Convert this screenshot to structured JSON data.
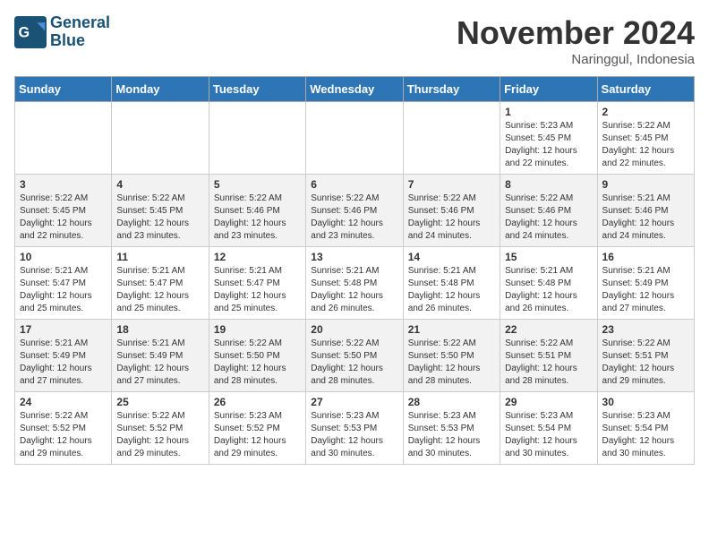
{
  "header": {
    "logo_line1": "General",
    "logo_line2": "Blue",
    "month": "November 2024",
    "location": "Naringgul, Indonesia"
  },
  "days_of_week": [
    "Sunday",
    "Monday",
    "Tuesday",
    "Wednesday",
    "Thursday",
    "Friday",
    "Saturday"
  ],
  "weeks": [
    [
      {
        "day": "",
        "info": ""
      },
      {
        "day": "",
        "info": ""
      },
      {
        "day": "",
        "info": ""
      },
      {
        "day": "",
        "info": ""
      },
      {
        "day": "",
        "info": ""
      },
      {
        "day": "1",
        "info": "Sunrise: 5:23 AM\nSunset: 5:45 PM\nDaylight: 12 hours\nand 22 minutes."
      },
      {
        "day": "2",
        "info": "Sunrise: 5:22 AM\nSunset: 5:45 PM\nDaylight: 12 hours\nand 22 minutes."
      }
    ],
    [
      {
        "day": "3",
        "info": "Sunrise: 5:22 AM\nSunset: 5:45 PM\nDaylight: 12 hours\nand 22 minutes."
      },
      {
        "day": "4",
        "info": "Sunrise: 5:22 AM\nSunset: 5:45 PM\nDaylight: 12 hours\nand 23 minutes."
      },
      {
        "day": "5",
        "info": "Sunrise: 5:22 AM\nSunset: 5:46 PM\nDaylight: 12 hours\nand 23 minutes."
      },
      {
        "day": "6",
        "info": "Sunrise: 5:22 AM\nSunset: 5:46 PM\nDaylight: 12 hours\nand 23 minutes."
      },
      {
        "day": "7",
        "info": "Sunrise: 5:22 AM\nSunset: 5:46 PM\nDaylight: 12 hours\nand 24 minutes."
      },
      {
        "day": "8",
        "info": "Sunrise: 5:22 AM\nSunset: 5:46 PM\nDaylight: 12 hours\nand 24 minutes."
      },
      {
        "day": "9",
        "info": "Sunrise: 5:21 AM\nSunset: 5:46 PM\nDaylight: 12 hours\nand 24 minutes."
      }
    ],
    [
      {
        "day": "10",
        "info": "Sunrise: 5:21 AM\nSunset: 5:47 PM\nDaylight: 12 hours\nand 25 minutes."
      },
      {
        "day": "11",
        "info": "Sunrise: 5:21 AM\nSunset: 5:47 PM\nDaylight: 12 hours\nand 25 minutes."
      },
      {
        "day": "12",
        "info": "Sunrise: 5:21 AM\nSunset: 5:47 PM\nDaylight: 12 hours\nand 25 minutes."
      },
      {
        "day": "13",
        "info": "Sunrise: 5:21 AM\nSunset: 5:48 PM\nDaylight: 12 hours\nand 26 minutes."
      },
      {
        "day": "14",
        "info": "Sunrise: 5:21 AM\nSunset: 5:48 PM\nDaylight: 12 hours\nand 26 minutes."
      },
      {
        "day": "15",
        "info": "Sunrise: 5:21 AM\nSunset: 5:48 PM\nDaylight: 12 hours\nand 26 minutes."
      },
      {
        "day": "16",
        "info": "Sunrise: 5:21 AM\nSunset: 5:49 PM\nDaylight: 12 hours\nand 27 minutes."
      }
    ],
    [
      {
        "day": "17",
        "info": "Sunrise: 5:21 AM\nSunset: 5:49 PM\nDaylight: 12 hours\nand 27 minutes."
      },
      {
        "day": "18",
        "info": "Sunrise: 5:21 AM\nSunset: 5:49 PM\nDaylight: 12 hours\nand 27 minutes."
      },
      {
        "day": "19",
        "info": "Sunrise: 5:22 AM\nSunset: 5:50 PM\nDaylight: 12 hours\nand 28 minutes."
      },
      {
        "day": "20",
        "info": "Sunrise: 5:22 AM\nSunset: 5:50 PM\nDaylight: 12 hours\nand 28 minutes."
      },
      {
        "day": "21",
        "info": "Sunrise: 5:22 AM\nSunset: 5:50 PM\nDaylight: 12 hours\nand 28 minutes."
      },
      {
        "day": "22",
        "info": "Sunrise: 5:22 AM\nSunset: 5:51 PM\nDaylight: 12 hours\nand 28 minutes."
      },
      {
        "day": "23",
        "info": "Sunrise: 5:22 AM\nSunset: 5:51 PM\nDaylight: 12 hours\nand 29 minutes."
      }
    ],
    [
      {
        "day": "24",
        "info": "Sunrise: 5:22 AM\nSunset: 5:52 PM\nDaylight: 12 hours\nand 29 minutes."
      },
      {
        "day": "25",
        "info": "Sunrise: 5:22 AM\nSunset: 5:52 PM\nDaylight: 12 hours\nand 29 minutes."
      },
      {
        "day": "26",
        "info": "Sunrise: 5:23 AM\nSunset: 5:52 PM\nDaylight: 12 hours\nand 29 minutes."
      },
      {
        "day": "27",
        "info": "Sunrise: 5:23 AM\nSunset: 5:53 PM\nDaylight: 12 hours\nand 30 minutes."
      },
      {
        "day": "28",
        "info": "Sunrise: 5:23 AM\nSunset: 5:53 PM\nDaylight: 12 hours\nand 30 minutes."
      },
      {
        "day": "29",
        "info": "Sunrise: 5:23 AM\nSunset: 5:54 PM\nDaylight: 12 hours\nand 30 minutes."
      },
      {
        "day": "30",
        "info": "Sunrise: 5:23 AM\nSunset: 5:54 PM\nDaylight: 12 hours\nand 30 minutes."
      }
    ]
  ]
}
